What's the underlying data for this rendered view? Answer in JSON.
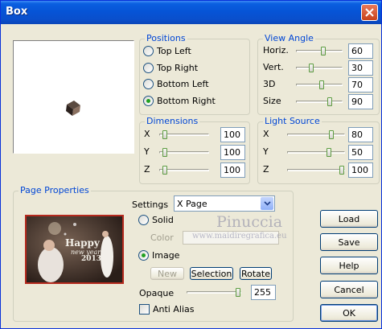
{
  "window": {
    "title": "Box"
  },
  "positions": {
    "label": "Positions",
    "options": [
      "Top Left",
      "Top Right",
      "Bottom Left",
      "Bottom Right"
    ],
    "selected": "Bottom Right"
  },
  "view_angle": {
    "label": "View Angle",
    "rows": [
      {
        "label": "Horiz.",
        "value": "60",
        "level": 0.6
      },
      {
        "label": "Vert.",
        "value": "30",
        "level": 0.3
      },
      {
        "label": "3D",
        "value": "70",
        "level": 0.55
      },
      {
        "label": "Size",
        "value": "90",
        "level": 0.75
      }
    ]
  },
  "dimensions": {
    "label": "Dimensions",
    "rows": [
      {
        "label": "X",
        "value": "100",
        "level": 0.05
      },
      {
        "label": "Y",
        "value": "100",
        "level": 0.05
      },
      {
        "label": "Z",
        "value": "100",
        "level": 0.05
      }
    ]
  },
  "light_source": {
    "label": "Light Source",
    "rows": [
      {
        "label": "X",
        "value": "80",
        "level": 0.8
      },
      {
        "label": "Y",
        "value": "50",
        "level": 0.75
      },
      {
        "label": "Z",
        "value": "100",
        "level": 1.0
      }
    ]
  },
  "page_properties": {
    "label": "Page Properties",
    "settings_label": "Settings",
    "settings_value": "X Page",
    "solid_label": "Solid",
    "color_label": "Color",
    "image_label": "Image",
    "new_label": "New",
    "selection_label": "Selection",
    "rotate_label": "Rotate",
    "opaque_label": "Opaque",
    "opaque_value": "255",
    "opaque_level": 1.0,
    "anti_alias_label": "Anti Alias",
    "selected_source": "Image",
    "thumbnail_text_1": "Happy",
    "thumbnail_text_2": "new year",
    "thumbnail_text_3": "2013"
  },
  "buttons": {
    "load": "Load",
    "save": "Save",
    "help": "Help",
    "cancel": "Cancel",
    "ok": "OK"
  },
  "watermark": {
    "line1": "Pinuccia",
    "line2": "www.maidiregrafica.eu"
  }
}
